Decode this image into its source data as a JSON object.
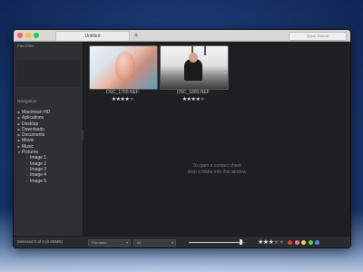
{
  "window": {
    "tab_title": "Untitled",
    "new_tab_glyph": "+",
    "search_placeholder": "Quick Search"
  },
  "sidebar": {
    "favorites_label": "Favorites",
    "navigation_label": "Navigation",
    "items": [
      {
        "label": "Macintosh HD",
        "expanded": false
      },
      {
        "label": "Aplications",
        "expanded": false
      },
      {
        "label": "Desktop",
        "expanded": false
      },
      {
        "label": "Downloads",
        "expanded": false
      },
      {
        "label": "Documents",
        "expanded": false
      },
      {
        "label": "Movie",
        "expanded": false
      },
      {
        "label": "Music",
        "expanded": false
      },
      {
        "label": "Pictures",
        "expanded": true
      },
      {
        "label": "Image 1",
        "child": true
      },
      {
        "label": "Image 2",
        "child": true
      },
      {
        "label": "Image 3",
        "child": true
      },
      {
        "label": "Image 4",
        "child": true
      },
      {
        "label": "Image 5",
        "child": true
      }
    ]
  },
  "content": {
    "thumbnails": [
      {
        "filename": "DSC_1760.NEF",
        "rating": 4,
        "max_rating": 5
      },
      {
        "filename": "DSC_1883.NEF",
        "rating": 4,
        "max_rating": 5
      }
    ],
    "empty_line1": "To open a contact sheet",
    "empty_line2": "drop a folder into this window"
  },
  "statusbar": {
    "selection_text": "Selected 0 of 0 (0.00MB)",
    "sort_value": "Filename",
    "filter_value": "All",
    "zoom_fraction": 0.92,
    "rating_filter": 3,
    "rating_max": 5,
    "label_colors": [
      "#e23b3b",
      "#e86fb5",
      "#f3d03b",
      "#5fcf4f",
      "#4a90e2"
    ]
  }
}
